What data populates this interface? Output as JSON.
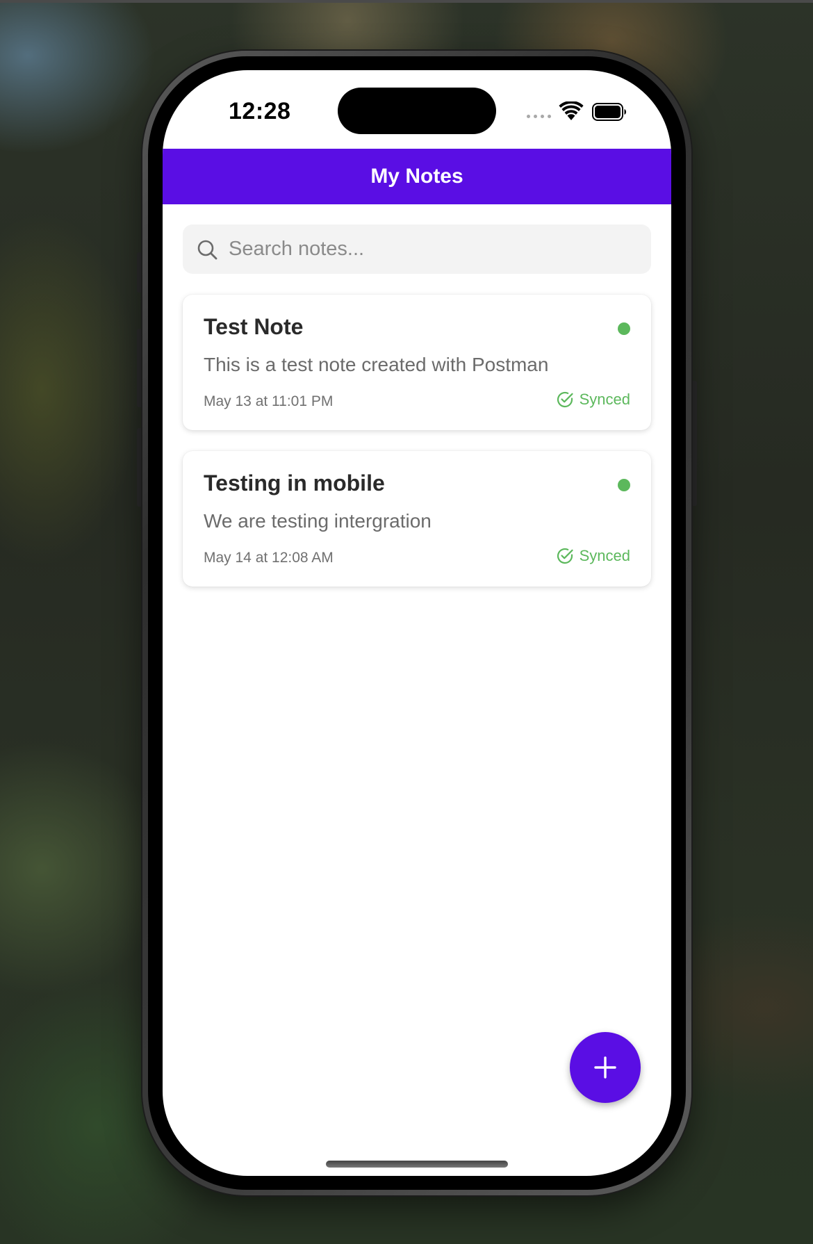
{
  "status_bar": {
    "time": "12:28"
  },
  "header": {
    "title": "My Notes",
    "background": "#5a0ee4"
  },
  "search": {
    "placeholder": "Search notes...",
    "value": "",
    "icon": "search-icon"
  },
  "notes": [
    {
      "title": "Test Note",
      "body": "This is a test note created with Postman",
      "date": "May 13 at 11:01 PM",
      "sync_label": "Synced",
      "sync_icon": "check-circle-icon",
      "status_color": "#5cb85c"
    },
    {
      "title": "Testing in mobile",
      "body": "We are testing intergration",
      "date": "May 14 at 12:08 AM",
      "sync_label": "Synced",
      "sync_icon": "check-circle-icon",
      "status_color": "#5cb85c"
    }
  ],
  "fab": {
    "icon": "plus-icon",
    "color": "#5a0ee4"
  },
  "colors": {
    "accent": "#5a0ee4",
    "synced": "#5cb85c"
  }
}
